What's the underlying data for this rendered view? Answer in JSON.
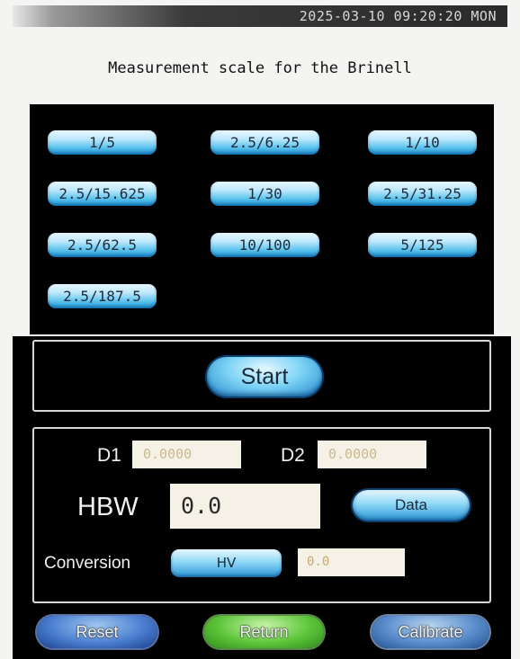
{
  "status": {
    "datetime": "2025-03-10 09:20:20 MON"
  },
  "title": "Measurement scale for the Brinell",
  "scales": [
    "1/5",
    "2.5/6.25",
    "1/10",
    "2.5/15.625",
    "1/30",
    "2.5/31.25",
    "2.5/62.5",
    "10/100",
    "5/125",
    "2.5/187.5"
  ],
  "start": {
    "label": "Start"
  },
  "measure": {
    "d1_label": "D1",
    "d1_value": "0.0000",
    "d2_label": "D2",
    "d2_value": "0.0000",
    "hbw_label": "HBW",
    "hbw_value": "0.0",
    "data_label": "Data",
    "conversion_label": "Conversion",
    "conversion_mode": "HV",
    "conversion_value": "0.0"
  },
  "bottom": {
    "reset": "Reset",
    "return": "Return",
    "calibrate": "Calibrate"
  },
  "colors": {
    "panel": "#000000",
    "accent_blue": "#2a96d6",
    "return_green": "#3fae2a",
    "field_bg": "#f6f1e6"
  }
}
